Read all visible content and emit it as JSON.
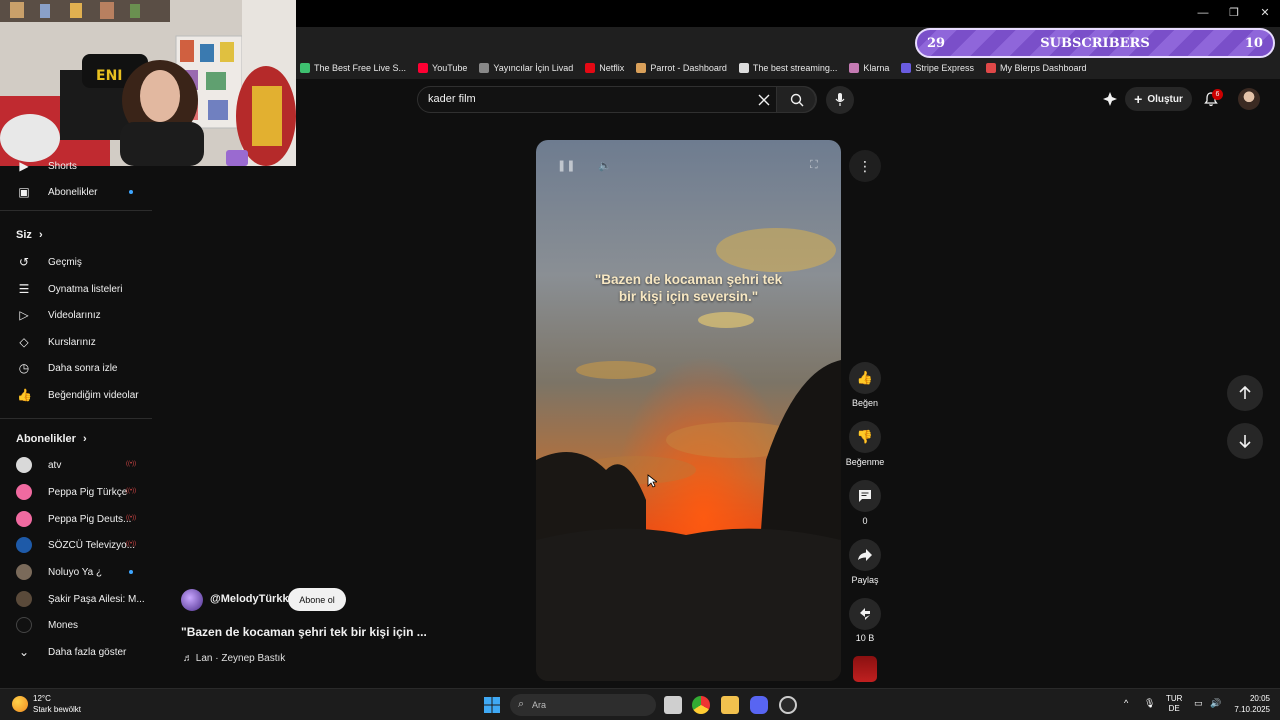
{
  "overlay": {
    "subscribers": {
      "left": "29",
      "label": "SUBSCRIBERS",
      "right": "10"
    }
  },
  "bookmarks": [
    {
      "label": "The Best Free Live S...",
      "icon": "stream-icon",
      "color": "#3ec070"
    },
    {
      "label": "YouTube",
      "icon": "youtube-icon",
      "color": "#ff0033"
    },
    {
      "label": "Yayıncılar İçin Livad",
      "icon": "livad-icon",
      "color": "#888888"
    },
    {
      "label": "Netflix",
      "icon": "netflix-icon",
      "color": "#e50914"
    },
    {
      "label": "Parrot - Dashboard",
      "icon": "parrot-icon",
      "color": "#d9a05a"
    },
    {
      "label": "The best streaming...",
      "icon": "diamond-icon",
      "color": "#dddddd"
    },
    {
      "label": "Klarna",
      "icon": "klarna-icon",
      "color": "#c47ab3"
    },
    {
      "label": "Stripe Express",
      "icon": "stripe-icon",
      "color": "#6a5ce0"
    },
    {
      "label": "My Blerps Dashboard",
      "icon": "blerps-icon",
      "color": "#e04848"
    }
  ],
  "search": {
    "value": "kader film"
  },
  "header": {
    "create_label": "Oluştur",
    "notifications_count": "6"
  },
  "sidebar": {
    "top_items": [
      {
        "label": "Shorts"
      },
      {
        "label": "Abonelikler"
      }
    ],
    "you_heading": "Siz",
    "you_items": [
      {
        "label": "Geçmiş",
        "icon": "history-icon"
      },
      {
        "label": "Oynatma listeleri",
        "icon": "playlist-icon"
      },
      {
        "label": "Videolarınız",
        "icon": "your-videos-icon"
      },
      {
        "label": "Kurslarınız",
        "icon": "courses-icon"
      },
      {
        "label": "Daha sonra izle",
        "icon": "watch-later-icon"
      },
      {
        "label": "Beğendiğim videolar",
        "icon": "liked-icon"
      }
    ],
    "subs_heading": "Abonelikler",
    "subscriptions": [
      {
        "label": "atv",
        "color": "#d9d9d9",
        "badge": "live"
      },
      {
        "label": "Peppa Pig Türkçe",
        "color": "#f06aa0",
        "badge": "live"
      },
      {
        "label": "Peppa Pig Deuts...",
        "color": "#f06aa0",
        "badge": "live"
      },
      {
        "label": "SÖZCÜ Televizyo...",
        "color": "#1e5aa8",
        "badge": "live"
      },
      {
        "label": "Noluyo Ya ¿",
        "color": "#7a6a5a",
        "badge": "dot"
      },
      {
        "label": "Şakir Paşa Ailesi: M...",
        "color": "#5a4a3a",
        "badge": ""
      },
      {
        "label": "Mones",
        "color": "#111111",
        "badge": ""
      }
    ],
    "show_more": "Daha fazla göster"
  },
  "video": {
    "caption_line1": "\"Bazen de kocaman şehri tek",
    "caption_line2": "bir kişi için seversin.\""
  },
  "actions": {
    "like": "Beğen",
    "dislike": "Beğenme",
    "comments": "0",
    "share": "Paylaş",
    "remix": "10 B"
  },
  "channel": {
    "handle": "@MelodyTürkk",
    "subscribe": "Abone ol",
    "title": "\"Bazen de kocaman şehri tek bir kişi için ...",
    "music": "♬ Lan · Zeynep Bastık"
  },
  "taskbar": {
    "weather_temp": "12°C",
    "weather_desc": "Stark bewölkt",
    "search_placeholder": "Ara",
    "lang_line1": "TUR",
    "lang_line2": "DE",
    "time": "20:05",
    "date": "7.10.2025"
  }
}
